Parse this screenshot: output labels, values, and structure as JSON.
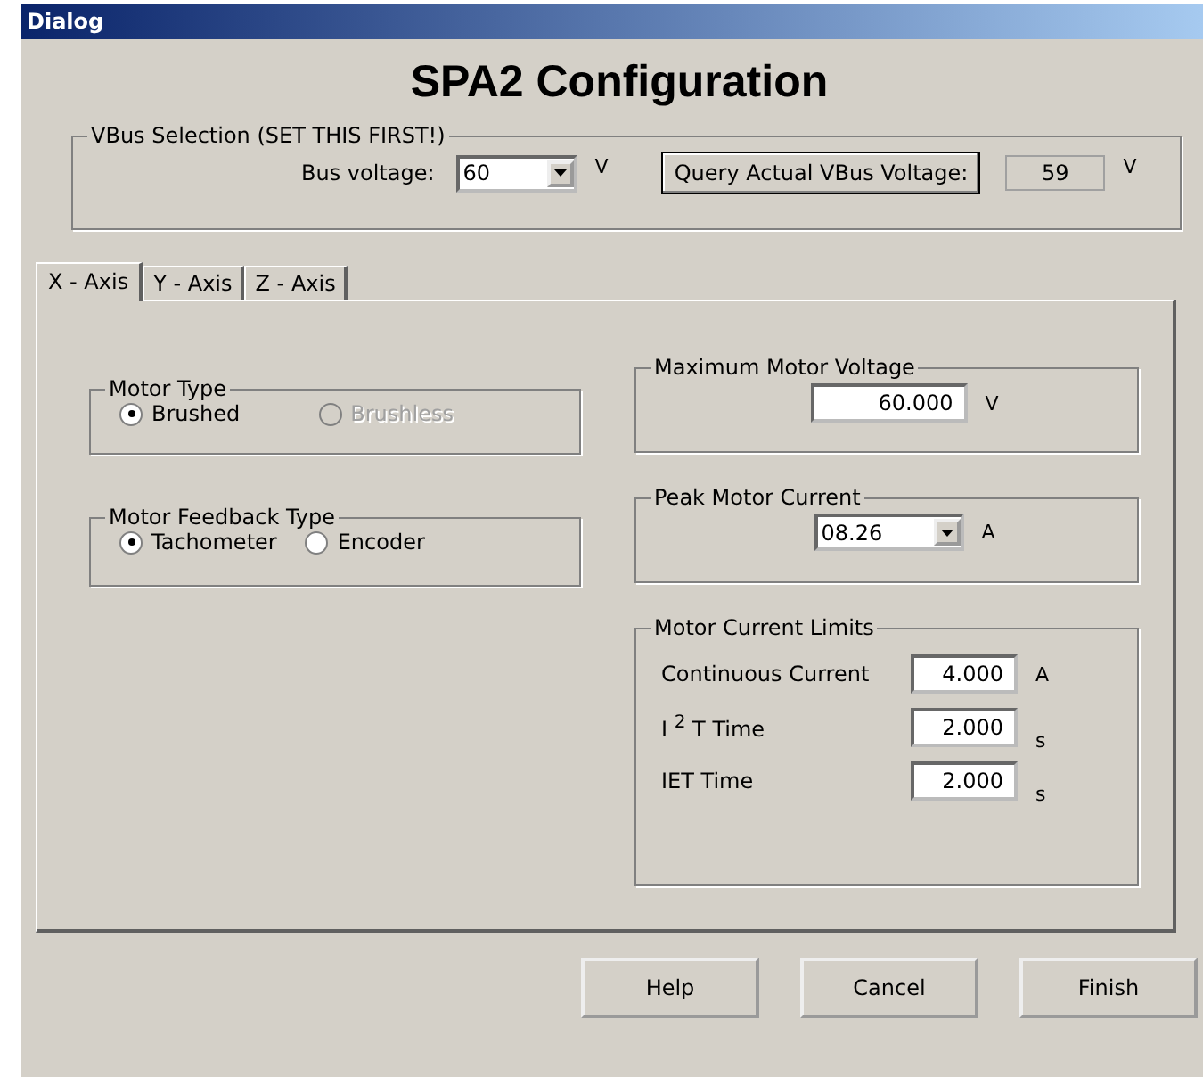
{
  "window": {
    "title": "Dialog"
  },
  "heading": "SPA2 Configuration",
  "vbus": {
    "legend": "VBus Selection (SET THIS FIRST!)",
    "bus_label": "Bus voltage:",
    "bus_value": "60",
    "bus_unit": "V",
    "query_button": "Query Actual VBus Voltage:",
    "actual_value": "59",
    "actual_unit": "V"
  },
  "tabs": [
    {
      "label": "X - Axis",
      "selected": true
    },
    {
      "label": "Y - Axis",
      "selected": false
    },
    {
      "label": "Z - Axis",
      "selected": false
    }
  ],
  "motor_type": {
    "legend": "Motor Type",
    "options": [
      {
        "label": "Brushed",
        "selected": true,
        "disabled": false
      },
      {
        "label": "Brushless",
        "selected": false,
        "disabled": true
      }
    ]
  },
  "feedback_type": {
    "legend": "Motor Feedback Type",
    "options": [
      {
        "label": "Tachometer",
        "selected": true,
        "disabled": false
      },
      {
        "label": "Encoder",
        "selected": false,
        "disabled": false
      }
    ]
  },
  "max_voltage": {
    "legend": "Maximum Motor Voltage",
    "value": "60.000",
    "unit": "V"
  },
  "peak_current": {
    "legend": "Peak Motor Current",
    "value": "08.26",
    "unit": "A"
  },
  "current_limits": {
    "legend": "Motor Current Limits",
    "rows": [
      {
        "label": "Continuous Current",
        "value": "4.000",
        "unit": "A"
      },
      {
        "label": "I $^{2}$ T Time",
        "value": "2.000",
        "unit": "s"
      },
      {
        "label": "IET Time",
        "value": "2.000",
        "unit": "s"
      }
    ]
  },
  "buttons": [
    "Help",
    "Cancel",
    "Finish"
  ]
}
